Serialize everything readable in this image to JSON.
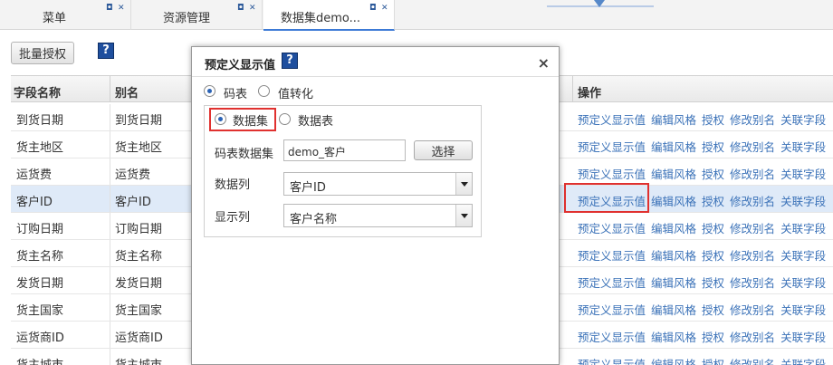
{
  "tabs": [
    {
      "label": "菜单"
    },
    {
      "label": "资源管理"
    },
    {
      "label": "数据集demo..."
    }
  ],
  "tab_controls": {
    "restore": "◘",
    "close": "✕"
  },
  "toolbar": {
    "batch_authorize": "批量授权",
    "help": "?"
  },
  "grid": {
    "headers": {
      "field_name": "字段名称",
      "alias": "别名",
      "operations": "操作"
    },
    "operations": [
      "预定义显示值",
      "编辑风格",
      "授权",
      "修改别名",
      "关联字段"
    ],
    "rows": [
      {
        "field": "到货日期",
        "alias": "到货日期"
      },
      {
        "field": "货主地区",
        "alias": "货主地区"
      },
      {
        "field": "运货费",
        "alias": "运货费"
      },
      {
        "field": "客户ID",
        "alias": "客户ID"
      },
      {
        "field": "订购日期",
        "alias": "订购日期"
      },
      {
        "field": "货主名称",
        "alias": "货主名称"
      },
      {
        "field": "发货日期",
        "alias": "发货日期"
      },
      {
        "field": "货主国家",
        "alias": "货主国家"
      },
      {
        "field": "运货商ID",
        "alias": "运货商ID"
      },
      {
        "field": "货主城市",
        "alias": "货主城市"
      }
    ],
    "selected_row": "客户ID"
  },
  "dialog": {
    "title": "预定义显示值",
    "help": "?",
    "close": "×",
    "mode_radios": {
      "code_table": "码表",
      "value_convert": "值转化"
    },
    "source_radios": {
      "dataset": "数据集",
      "data_table": "数据表"
    },
    "code_dataset_label": "码表数据集",
    "code_dataset_value": "demo_客户",
    "choose_button": "选择",
    "data_column_label": "数据列",
    "data_column_value": "客户ID",
    "display_column_label": "显示列",
    "display_column_value": "客户名称"
  },
  "colors": {
    "link": "#3b72b8",
    "highlight": "#e0312f",
    "selected_row": "#dfeaf8"
  }
}
